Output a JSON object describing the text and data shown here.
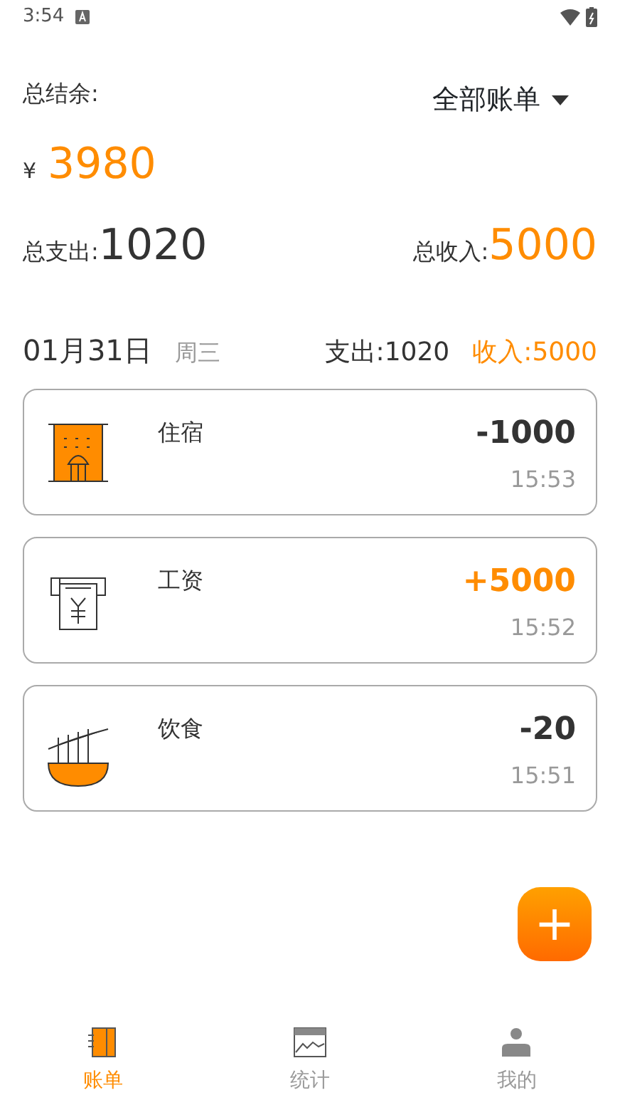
{
  "status_bar": {
    "time": "3:54"
  },
  "summary": {
    "balance_label": "总结余:",
    "filter": "全部账单",
    "currency": "¥",
    "balance": "3980",
    "expense_label": "总支出:",
    "expense": "1020",
    "income_label": "总收入:",
    "income": "5000"
  },
  "day": {
    "date": "01月31日",
    "weekday": "周三",
    "expense": "支出:1020",
    "income": "收入:5000"
  },
  "records": [
    {
      "kind": "hotel",
      "category": "住宿",
      "amount": "-1000",
      "income": false,
      "time": "15:53"
    },
    {
      "kind": "salary",
      "category": "工资",
      "amount": "+5000",
      "income": true,
      "time": "15:52"
    },
    {
      "kind": "food",
      "category": "饮食",
      "amount": "-20",
      "income": false,
      "time": "15:51"
    }
  ],
  "add_button": "+",
  "tabs": [
    {
      "kind": "bills",
      "label": "账单",
      "selected": true
    },
    {
      "kind": "stats",
      "label": "统计",
      "selected": false
    },
    {
      "kind": "profile",
      "label": "我的",
      "selected": false
    }
  ]
}
